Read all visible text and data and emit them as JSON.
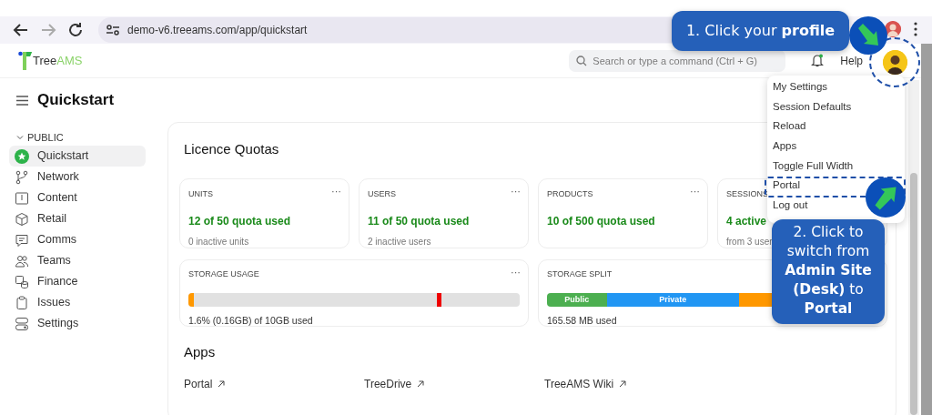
{
  "browser": {
    "url": "demo-v6.treeams.com/app/quickstart"
  },
  "header": {
    "logo": "Tree",
    "logo_accent": "AMS",
    "search": {
      "placeholder": "Search or type a command (Ctrl + G)"
    },
    "help": "Help"
  },
  "page_title": "Quickstart",
  "sidebar": {
    "section": "PUBLIC",
    "expanded": true,
    "items": [
      {
        "label": "Quickstart",
        "selected": true
      },
      {
        "label": "Network",
        "selected": false
      },
      {
        "label": "Content",
        "selected": false
      },
      {
        "label": "Retail",
        "selected": false
      },
      {
        "label": "Comms",
        "selected": false
      },
      {
        "label": "Teams",
        "selected": false
      },
      {
        "label": "Finance",
        "selected": false
      },
      {
        "label": "Issues",
        "selected": false
      },
      {
        "label": "Settings",
        "selected": false
      }
    ]
  },
  "quotas": {
    "title": "Licence Quotas",
    "cards": [
      {
        "label": "UNITS",
        "menu": "···",
        "value": "12 of 50 quota used",
        "note": "0 inactive units"
      },
      {
        "label": "USERS",
        "menu": "···",
        "value": "11 of 50 quota used",
        "note": "2 inactive users"
      },
      {
        "label": "PRODUCTS",
        "menu": "···",
        "value": "10 of 500 quota used"
      },
      {
        "label": "SESSIONS",
        "value": "4 active",
        "note": "from 3 user"
      }
    ]
  },
  "storage": [
    {
      "label": "STORAGE USAGE",
      "menu": "···",
      "kind": "usage",
      "segments": [
        {
          "kind": "fill",
          "level": 0.016
        },
        {
          "kind": "marker",
          "level": 0.75
        }
      ],
      "caption": "1.6% (0.16GB) of 10GB used"
    },
    {
      "label": "STORAGE SPLIT",
      "kind": "split",
      "segments": [
        {
          "label": "Public",
          "color": "#4caf50",
          "level": 0.18
        },
        {
          "label": "Private",
          "color": "#2196f3",
          "level": 0.4
        },
        {
          "color": "#ff9800",
          "level": 0.42
        }
      ],
      "caption": "165.58 MB used"
    }
  ],
  "apps": {
    "title": "Apps",
    "links": [
      "Portal",
      "TreeDrive",
      "TreeAMS Wiki"
    ]
  },
  "menu": {
    "items": [
      {
        "label": "My Settings",
        "highlighted": false
      },
      {
        "label": "Session Defaults",
        "highlighted": false
      },
      {
        "label": "Reload",
        "highlighted": false
      },
      {
        "label": "Apps",
        "highlighted": false
      },
      {
        "label": "Toggle Full Width",
        "highlighted": false
      },
      {
        "label": "Portal",
        "highlighted": true
      },
      {
        "label": "Log out",
        "highlighted": false
      }
    ]
  },
  "callouts": [
    {
      "text": "1. Click your **profile**"
    },
    {
      "text": "2. Click to switch from **Admin Site (Desk)** to **Portal**"
    }
  ]
}
